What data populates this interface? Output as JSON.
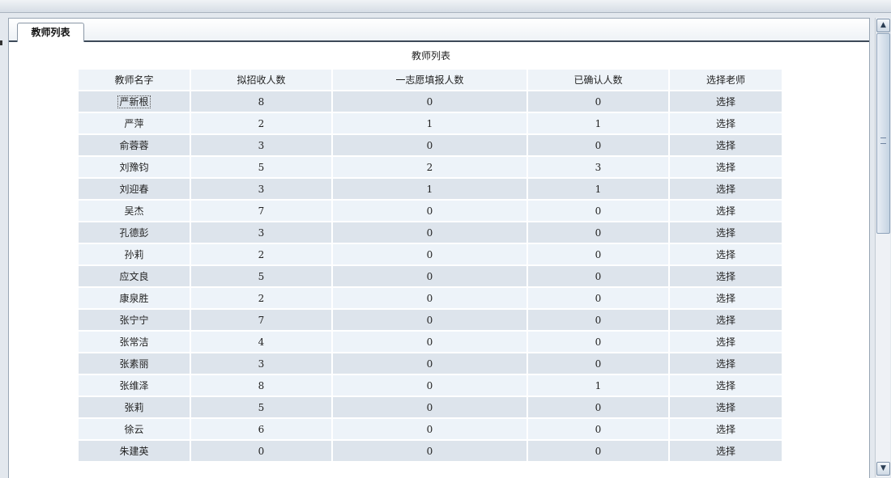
{
  "tab": {
    "label": "教师列表"
  },
  "table": {
    "title": "教师列表",
    "columns": [
      "教师名字",
      "拟招收人数",
      "一志愿填报人数",
      "已确认人数",
      "选择老师"
    ],
    "rows": [
      {
        "name": "严新根",
        "quota": "8",
        "first_choice": "0",
        "confirmed": "0",
        "action": "选择"
      },
      {
        "name": "严萍",
        "quota": "2",
        "first_choice": "1",
        "confirmed": "1",
        "action": "选择"
      },
      {
        "name": "俞蓉蓉",
        "quota": "3",
        "first_choice": "0",
        "confirmed": "0",
        "action": "选择"
      },
      {
        "name": "刘豫钧",
        "quota": "5",
        "first_choice": "2",
        "confirmed": "3",
        "action": "选择"
      },
      {
        "name": "刘迎春",
        "quota": "3",
        "first_choice": "1",
        "confirmed": "1",
        "action": "选择"
      },
      {
        "name": "吴杰",
        "quota": "7",
        "first_choice": "0",
        "confirmed": "0",
        "action": "选择"
      },
      {
        "name": "孔德彭",
        "quota": "3",
        "first_choice": "0",
        "confirmed": "0",
        "action": "选择"
      },
      {
        "name": "孙莉",
        "quota": "2",
        "first_choice": "0",
        "confirmed": "0",
        "action": "选择"
      },
      {
        "name": "应文良",
        "quota": "5",
        "first_choice": "0",
        "confirmed": "0",
        "action": "选择"
      },
      {
        "name": "康泉胜",
        "quota": "2",
        "first_choice": "0",
        "confirmed": "0",
        "action": "选择"
      },
      {
        "name": "张宁宁",
        "quota": "7",
        "first_choice": "0",
        "confirmed": "0",
        "action": "选择"
      },
      {
        "name": "张常洁",
        "quota": "4",
        "first_choice": "0",
        "confirmed": "0",
        "action": "选择"
      },
      {
        "name": "张素丽",
        "quota": "3",
        "first_choice": "0",
        "confirmed": "0",
        "action": "选择"
      },
      {
        "name": "张维泽",
        "quota": "8",
        "first_choice": "0",
        "confirmed": "1",
        "action": "选择"
      },
      {
        "name": "张莉",
        "quota": "5",
        "first_choice": "0",
        "confirmed": "0",
        "action": "选择"
      },
      {
        "name": "徐云",
        "quota": "6",
        "first_choice": "0",
        "confirmed": "0",
        "action": "选择"
      },
      {
        "name": "朱建英",
        "quota": "0",
        "first_choice": "0",
        "confirmed": "0",
        "action": "选择"
      }
    ]
  },
  "scrollbar": {
    "up_icon": "scroll-up-arrow-icon",
    "down_icon": "scroll-down-arrow-icon"
  },
  "colors": {
    "row_odd": "#dde4ec",
    "row_even": "#edf3f9",
    "tab_underline": "#3d4a58"
  }
}
